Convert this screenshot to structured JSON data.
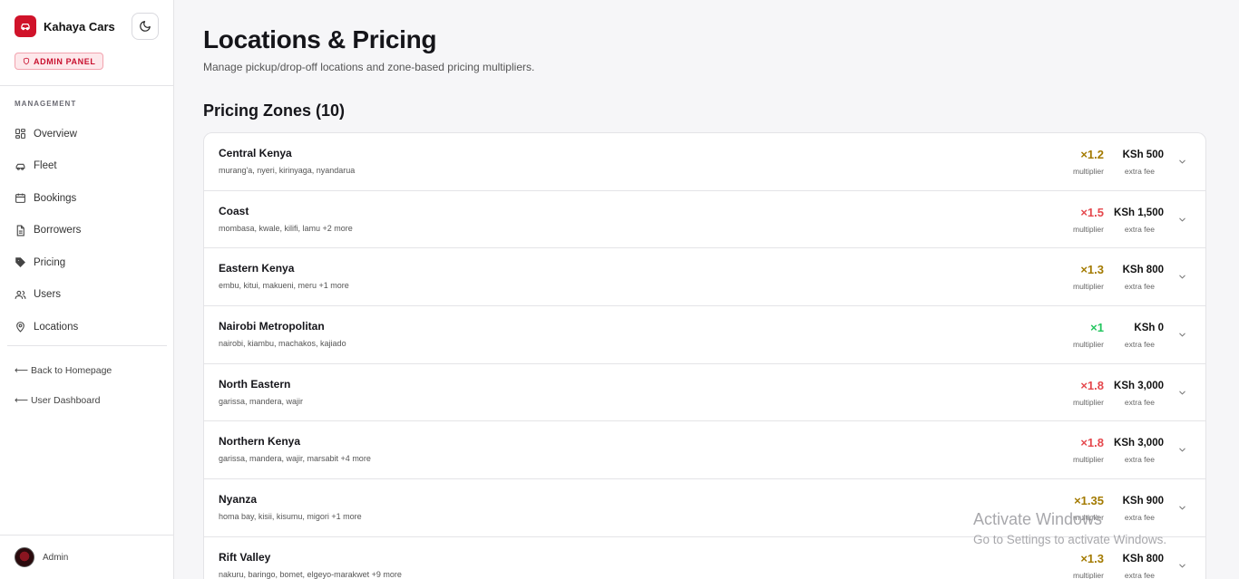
{
  "brand": {
    "name": "Kahaya Cars",
    "badge": "ADMIN PANEL"
  },
  "sidebar": {
    "section_label": "MANAGEMENT",
    "items": [
      {
        "label": "Overview",
        "icon": "grid-icon"
      },
      {
        "label": "Fleet",
        "icon": "car-icon"
      },
      {
        "label": "Bookings",
        "icon": "calendar-icon"
      },
      {
        "label": "Borrowers",
        "icon": "document-icon"
      },
      {
        "label": "Pricing",
        "icon": "tag-icon"
      },
      {
        "label": "Users",
        "icon": "users-icon"
      },
      {
        "label": "Locations",
        "icon": "map-pin-icon"
      }
    ],
    "links": [
      {
        "label": "⟵ Back to Homepage"
      },
      {
        "label": "⟵ User Dashboard"
      }
    ],
    "user": {
      "name": "Admin"
    }
  },
  "page": {
    "title": "Locations & Pricing",
    "subtitle": "Manage pickup/drop-off locations and zone-based pricing multipliers.",
    "section_title": "Pricing Zones (10)"
  },
  "labels": {
    "multiplier": "multiplier",
    "extra_fee": "extra fee"
  },
  "zones": [
    {
      "name": "Central Kenya",
      "areas": "murang'a, nyeri, kirinyaga, nyandarua",
      "multiplier": "×1.2",
      "fee": "KSh 500",
      "color": "#a37a00"
    },
    {
      "name": "Coast",
      "areas": "mombasa, kwale, kilifi, lamu +2 more",
      "multiplier": "×1.5",
      "fee": "KSh 1,500",
      "color": "#e5484d"
    },
    {
      "name": "Eastern Kenya",
      "areas": "embu, kitui, makueni, meru +1 more",
      "multiplier": "×1.3",
      "fee": "KSh 800",
      "color": "#a37a00"
    },
    {
      "name": "Nairobi Metropolitan",
      "areas": "nairobi, kiambu, machakos, kajiado",
      "multiplier": "×1",
      "fee": "KSh 0",
      "color": "#22c55e"
    },
    {
      "name": "North Eastern",
      "areas": "garissa, mandera, wajir",
      "multiplier": "×1.8",
      "fee": "KSh 3,000",
      "color": "#e5484d"
    },
    {
      "name": "Northern Kenya",
      "areas": "garissa, mandera, wajir, marsabit +4 more",
      "multiplier": "×1.8",
      "fee": "KSh 3,000",
      "color": "#e5484d"
    },
    {
      "name": "Nyanza",
      "areas": "homa bay, kisii, kisumu, migori +1 more",
      "multiplier": "×1.35",
      "fee": "KSh 900",
      "color": "#a37a00"
    },
    {
      "name": "Rift Valley",
      "areas": "nakuru, baringo, bomet, elgeyo-marakwet +9 more",
      "multiplier": "×1.3",
      "fee": "KSh 800",
      "color": "#a37a00"
    }
  ],
  "watermark": {
    "line1": "Activate Windows",
    "line2": "Go to Settings to activate Windows."
  }
}
